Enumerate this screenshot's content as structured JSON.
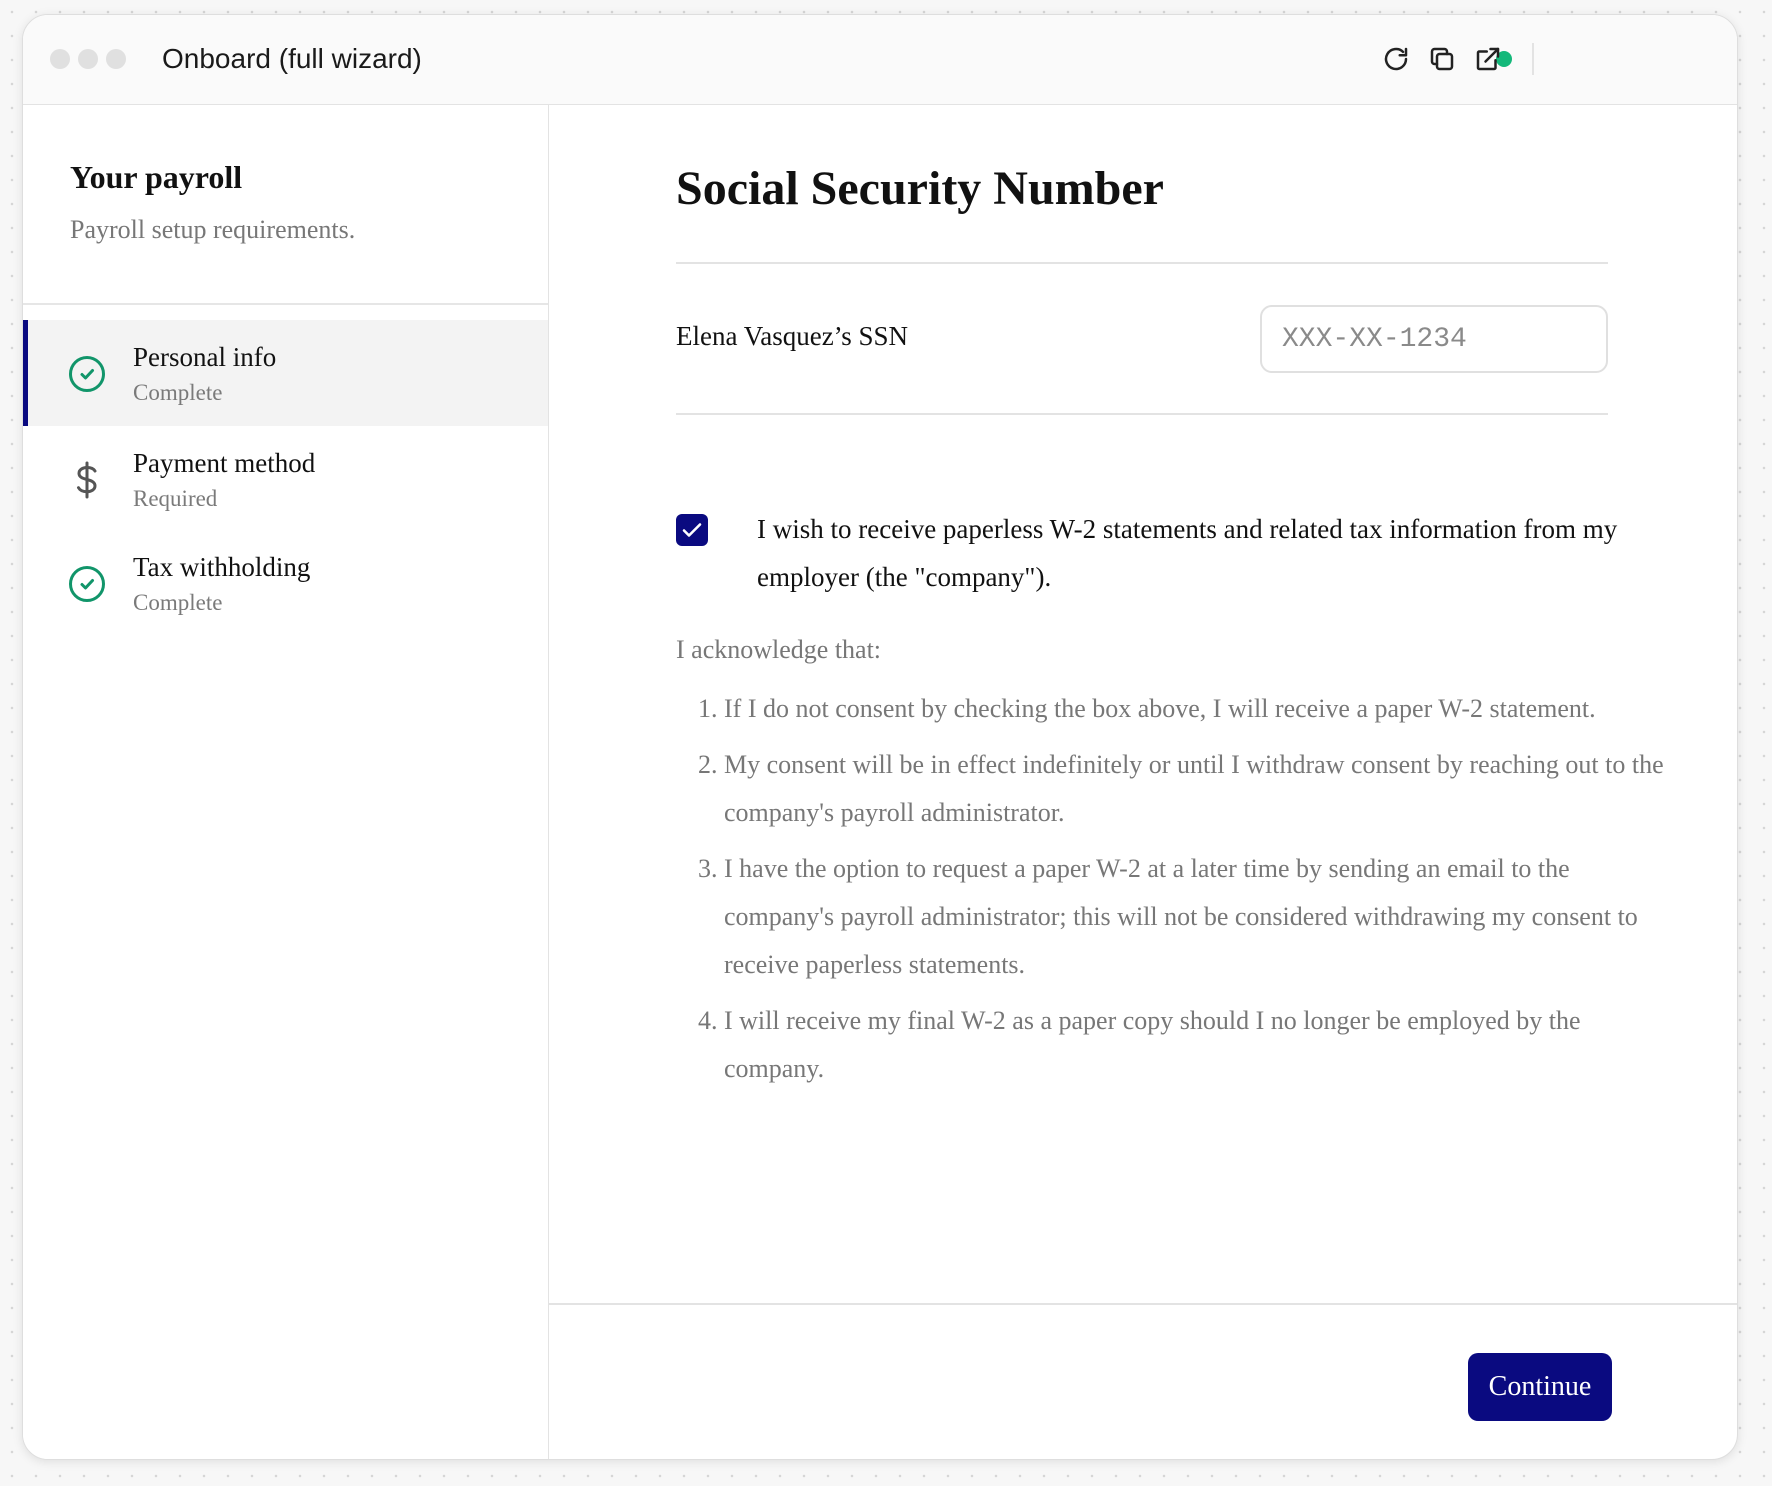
{
  "window": {
    "title": "Onboard (full wizard)",
    "toolbar": {
      "status_color": "#14b87a",
      "icons": [
        "refresh-icon",
        "copy-icon",
        "external-link-icon"
      ]
    }
  },
  "sidebar": {
    "title": "Your payroll",
    "subtitle": "Payroll setup requirements.",
    "steps": [
      {
        "label": "Personal info",
        "status": "Complete",
        "icon": "check-circle-icon",
        "active": true
      },
      {
        "label": "Payment method",
        "status": "Required",
        "icon": "dollar-icon",
        "active": false
      },
      {
        "label": "Tax withholding",
        "status": "Complete",
        "icon": "check-circle-icon",
        "active": false
      }
    ]
  },
  "main": {
    "title": "Social Security Number",
    "ssn_label": "Elena Vasquez’s SSN",
    "ssn_placeholder": "XXX-XX-1234",
    "ssn_value": "",
    "consent_checked": true,
    "consent_text": "I wish to receive paperless W-2 statements and related tax information from my employer (the \"company\").",
    "ack_intro": "I acknowledge that:",
    "ack_items": [
      "If I do not consent by checking the box above, I will receive a paper W-2 statement.",
      "My consent will be in effect indefinitely or until I withdraw consent by reaching out to the company's payroll administrator.",
      "I have the option to request a paper W-2 at a later time by sending an email to the company's payroll administrator; this will not be considered withdrawing my consent to receive paperless statements.",
      "I will receive my final W-2 as a paper copy should I no longer be employed by the company."
    ],
    "continue_label": "Continue"
  },
  "colors": {
    "accent": "#0a0a80",
    "success": "#11956a",
    "muted_text": "#777777"
  }
}
